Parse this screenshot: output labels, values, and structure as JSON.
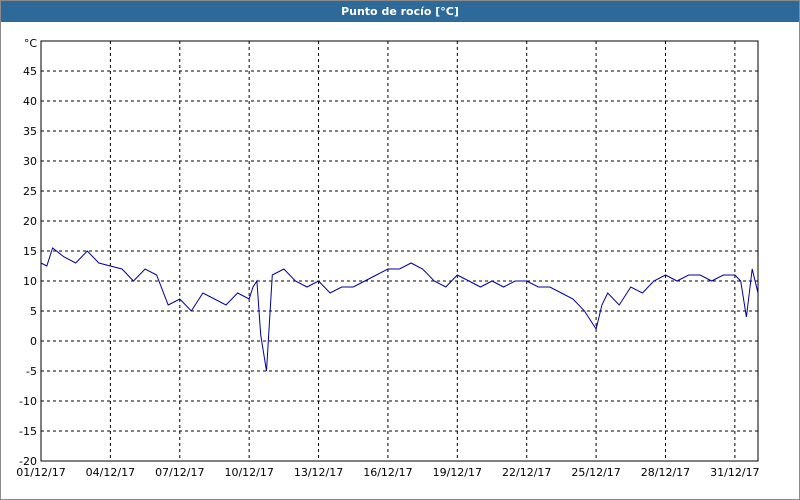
{
  "window": {
    "title": "Punto de rocío [°C]"
  },
  "colors": {
    "titlebar": "#2d6a9a",
    "series": "#0000a0",
    "grid": "#000000"
  },
  "chart_data": {
    "type": "line",
    "title": "Punto de rocío [°C]",
    "ylabel": "°C",
    "xlabel": "",
    "ylim": [
      -20,
      50
    ],
    "yticks": [
      -20,
      -15,
      -10,
      -5,
      0,
      5,
      10,
      15,
      20,
      25,
      30,
      35,
      40,
      45
    ],
    "xlim": [
      "2017-12-01",
      "2018-01-01"
    ],
    "xtick_labels": [
      "01/12/17",
      "04/12/17",
      "07/12/17",
      "10/12/17",
      "13/12/17",
      "16/12/17",
      "19/12/17",
      "22/12/17",
      "25/12/17",
      "28/12/17",
      "31/12/17"
    ],
    "grid": true,
    "grid_style": "dashed",
    "series": [
      {
        "x": [
          "2017-12-01 00:00",
          "2017-12-01 06:00",
          "2017-12-01 12:00",
          "2017-12-02 00:00",
          "2017-12-02 12:00",
          "2017-12-03 00:00",
          "2017-12-03 12:00",
          "2017-12-04 00:00",
          "2017-12-04 12:00",
          "2017-12-05 00:00",
          "2017-12-05 12:00",
          "2017-12-06 00:00",
          "2017-12-06 12:00",
          "2017-12-07 00:00",
          "2017-12-07 12:00",
          "2017-12-08 00:00",
          "2017-12-08 12:00",
          "2017-12-09 00:00",
          "2017-12-09 12:00",
          "2017-12-10 00:00",
          "2017-12-10 04:00",
          "2017-12-10 08:00",
          "2017-12-10 12:00",
          "2017-12-10 18:00",
          "2017-12-11 00:00",
          "2017-12-11 12:00",
          "2017-12-12 00:00",
          "2017-12-12 12:00",
          "2017-12-13 00:00",
          "2017-12-13 12:00",
          "2017-12-14 00:00",
          "2017-12-14 12:00",
          "2017-12-15 00:00",
          "2017-12-15 12:00",
          "2017-12-16 00:00",
          "2017-12-16 12:00",
          "2017-12-17 00:00",
          "2017-12-17 12:00",
          "2017-12-18 00:00",
          "2017-12-18 12:00",
          "2017-12-19 00:00",
          "2017-12-19 12:00",
          "2017-12-20 00:00",
          "2017-12-20 12:00",
          "2017-12-21 00:00",
          "2017-12-21 12:00",
          "2017-12-22 00:00",
          "2017-12-22 12:00",
          "2017-12-23 00:00",
          "2017-12-23 12:00",
          "2017-12-24 00:00",
          "2017-12-24 12:00",
          "2017-12-25 00:00",
          "2017-12-25 06:00",
          "2017-12-25 12:00",
          "2017-12-26 00:00",
          "2017-12-26 12:00",
          "2017-12-27 00:00",
          "2017-12-27 12:00",
          "2017-12-28 00:00",
          "2017-12-28 12:00",
          "2017-12-29 00:00",
          "2017-12-29 12:00",
          "2017-12-30 00:00",
          "2017-12-30 12:00",
          "2017-12-31 00:00",
          "2017-12-31 06:00",
          "2017-12-31 12:00",
          "2017-12-31 18:00",
          "2018-01-01 00:00"
        ],
        "values": [
          13,
          12.5,
          15.5,
          14,
          13,
          15,
          13,
          12.5,
          12,
          10,
          12,
          11,
          6,
          7,
          5,
          8,
          7,
          6,
          8,
          7,
          9,
          10,
          1,
          -5,
          11,
          12,
          10,
          9,
          10,
          8,
          9,
          9,
          10,
          11,
          12,
          12,
          13,
          12,
          10,
          9,
          11,
          10,
          9,
          10,
          9,
          10,
          10,
          9,
          9,
          8,
          7,
          5,
          2,
          6,
          8,
          6,
          9,
          8,
          10,
          11,
          10,
          11,
          11,
          10,
          11,
          11,
          10,
          4,
          12,
          8
        ]
      }
    ]
  }
}
